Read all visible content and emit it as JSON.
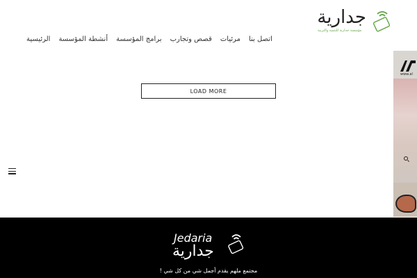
{
  "header": {
    "logo_text": "جدارية",
    "logo_tagline": "مؤسسة جدارية للتنمية والتربية",
    "nav": [
      "الرئيسية",
      "أنشطة المؤسسة",
      "برامج المؤسسة",
      "قصص وتجارب",
      "مرئيات",
      "اتصل بنا"
    ]
  },
  "main": {
    "load_more_label": "LOAD MORE"
  },
  "side_banner": {
    "url_text": "www.al"
  },
  "footer": {
    "brand_en": "Jedaria",
    "brand_ar": "جدارية",
    "tagline": "مجتمع ملهم يقدم أجمل شي من كل شي !"
  },
  "colors": {
    "accent_green": "#6aa84f",
    "footer_bg": "#000000"
  },
  "icons": {
    "menu": "hamburger-icon",
    "search": "search-icon",
    "logo": "wifi-card-icon"
  }
}
